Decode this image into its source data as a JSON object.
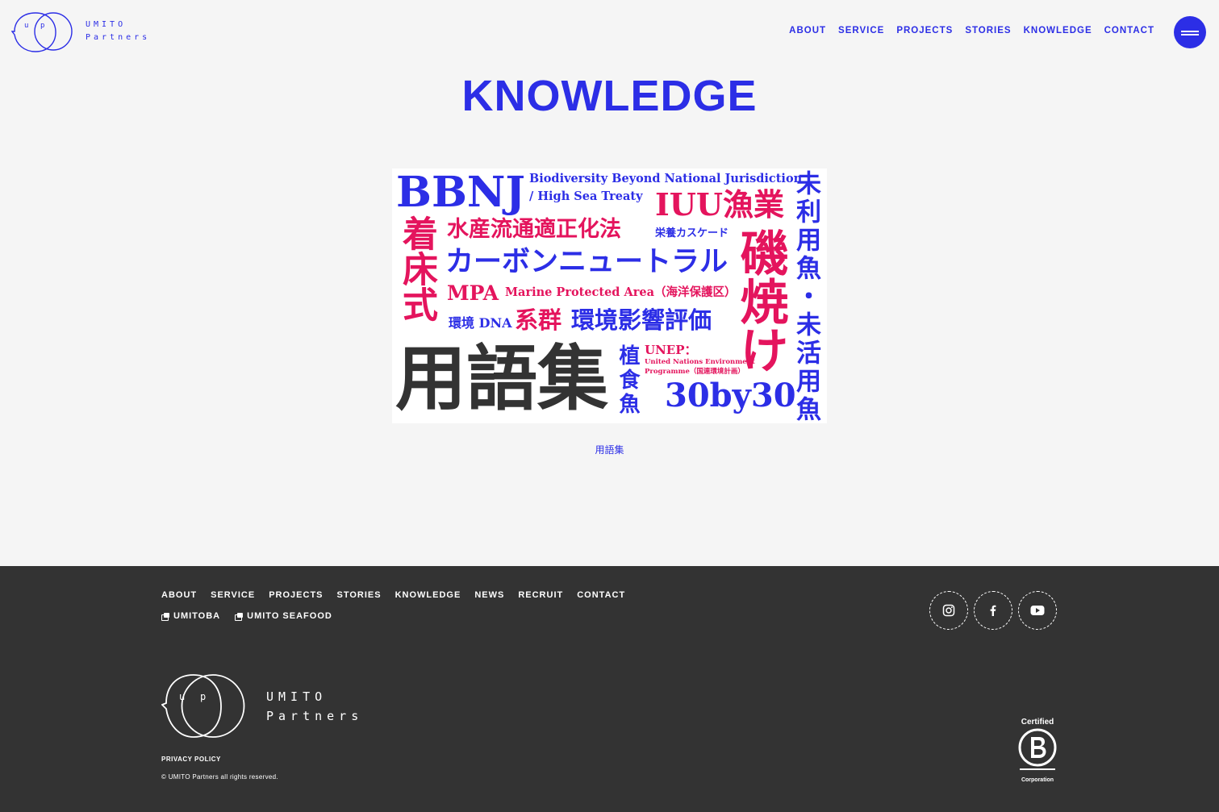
{
  "header": {
    "logo": {
      "line1": "UMITO",
      "line2": "Partners",
      "mark": "up"
    },
    "nav": [
      "ABOUT",
      "SERVICE",
      "PROJECTS",
      "STORIES",
      "KNOWLEDGE",
      "CONTACT"
    ],
    "menu_icon": "hamburger-icon"
  },
  "main": {
    "title": "KNOWLEDGE",
    "card": {
      "caption": "用語集",
      "image_text": {
        "bbnj": "BBNJ",
        "bbnj_en1": "Biodiversity Beyond National Jurisdiction",
        "bbnj_en2": "/ High Sea Treaty",
        "iuu": "IUU漁業",
        "suisan": "水産流通適正化法",
        "eiyo": "栄養カスケード",
        "carbon": "カーボンニュートラル",
        "mpa": "MPA",
        "mpa_en": "Marine Protected Area（海洋保護区）",
        "edna": "環境 DNA",
        "keigun": "系群",
        "kankyo": "環境影響評価",
        "chakusho": "着床式",
        "isoyake": "磯焼け",
        "miriyo": "未利用魚・未活用魚",
        "yougo": "用語集",
        "shokushoku": "植食魚",
        "unep": "UNEP：",
        "unep_en1": "United Nations Environment",
        "unep_en2": "Programme（国連環境計画）",
        "by30": "30by30"
      }
    }
  },
  "footer": {
    "nav": [
      "ABOUT",
      "SERVICE",
      "PROJECTS",
      "STORIES",
      "KNOWLEDGE",
      "NEWS",
      "RECRUIT",
      "CONTACT"
    ],
    "sub_links": [
      "UMITOBA",
      "UMITO SEAFOOD"
    ],
    "social": [
      "instagram-icon",
      "facebook-icon",
      "youtube-icon"
    ],
    "logo": {
      "line1": "UMITO",
      "line2": "Partners"
    },
    "privacy": "PRIVACY POLICY",
    "copyright": "© UMITO Partners all rights reserved.",
    "bcorp": {
      "top": "Certified",
      "bottom": "Corporation"
    }
  },
  "colors": {
    "accent": "#2c2ee6",
    "pink": "#e4145d",
    "footer_bg": "#333333",
    "page_bg": "#f5f5f5"
  }
}
